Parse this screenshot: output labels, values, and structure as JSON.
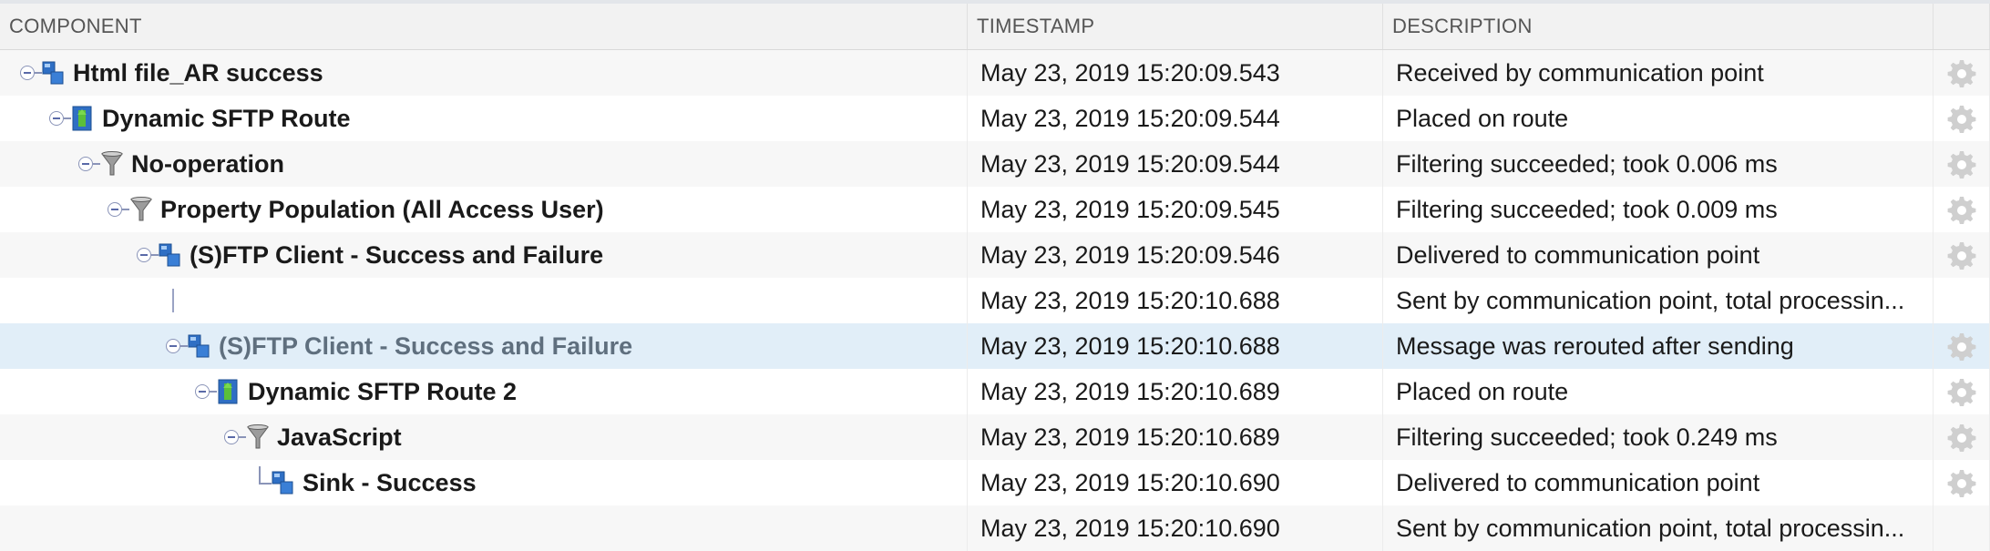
{
  "columns": {
    "component": "COMPONENT",
    "timestamp": "TIMESTAMP",
    "description": "DESCRIPTION"
  },
  "rows": [
    {
      "component": "Html file_AR success",
      "icon": "communication-point-icon",
      "timestamp": "May 23, 2019 15:20:09.543",
      "description": "Received by communication point",
      "gear": true
    },
    {
      "component": "Dynamic SFTP Route",
      "icon": "route-icon",
      "timestamp": "May 23, 2019 15:20:09.544",
      "description": "Placed on route",
      "gear": true
    },
    {
      "component": "No-operation",
      "icon": "filter-icon",
      "timestamp": "May 23, 2019 15:20:09.544",
      "description": "Filtering succeeded; took 0.006 ms",
      "gear": true
    },
    {
      "component": "Property Population (All Access User)",
      "icon": "filter-icon",
      "timestamp": "May 23, 2019 15:20:09.545",
      "description": "Filtering succeeded; took 0.009 ms",
      "gear": true
    },
    {
      "component": "(S)FTP Client - Success and Failure",
      "icon": "communication-point-icon",
      "timestamp": "May 23, 2019 15:20:09.546",
      "description": "Delivered to communication point",
      "gear": true
    },
    {
      "component": "",
      "icon": "",
      "timestamp": "May 23, 2019 15:20:10.688",
      "description": "Sent by communication point, total processin...",
      "gear": false
    },
    {
      "component": "(S)FTP Client - Success and Failure",
      "icon": "communication-point-icon",
      "timestamp": "May 23, 2019 15:20:10.688",
      "description": "Message was rerouted after sending",
      "gear": true,
      "selected": true
    },
    {
      "component": "Dynamic SFTP Route 2",
      "icon": "route-icon",
      "timestamp": "May 23, 2019 15:20:10.689",
      "description": "Placed on route",
      "gear": true
    },
    {
      "component": "JavaScript",
      "icon": "filter-icon",
      "timestamp": "May 23, 2019 15:20:10.689",
      "description": "Filtering succeeded; took 0.249 ms",
      "gear": true
    },
    {
      "component": "Sink - Success",
      "icon": "communication-point-icon",
      "timestamp": "May 23, 2019 15:20:10.690",
      "description": "Delivered to communication point",
      "gear": true
    },
    {
      "component": "",
      "icon": "",
      "timestamp": "May 23, 2019 15:20:10.690",
      "description": "Sent by communication point, total processin...",
      "gear": false
    }
  ]
}
